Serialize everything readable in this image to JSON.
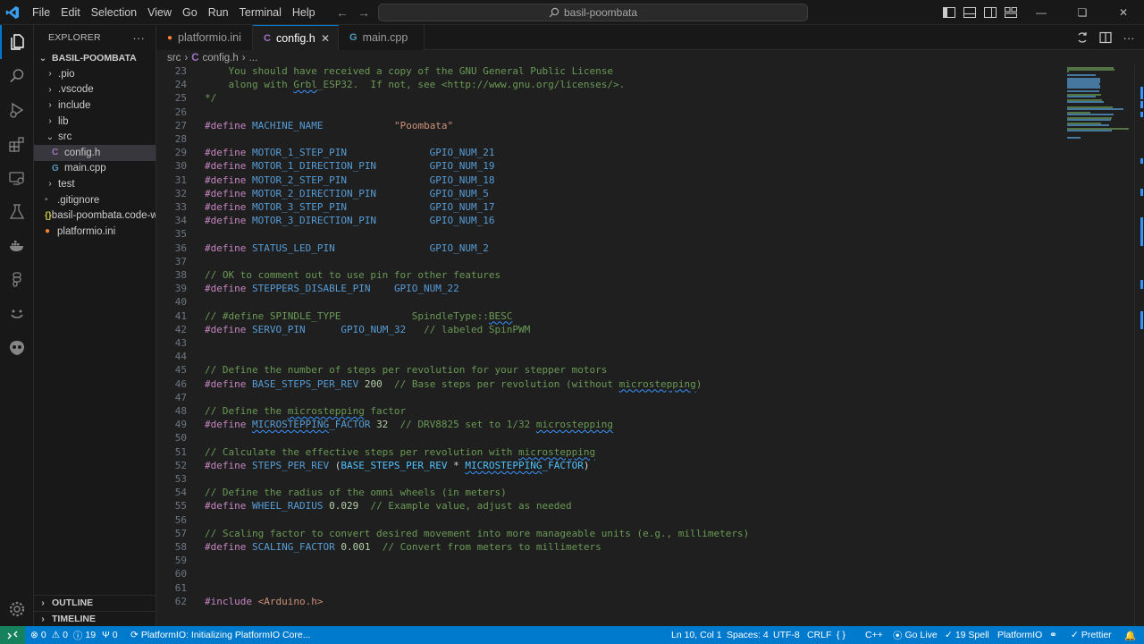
{
  "titlebar": {
    "menu": [
      "File",
      "Edit",
      "Selection",
      "View",
      "Go",
      "Run",
      "Terminal",
      "Help"
    ],
    "search_text": "basil-poombata"
  },
  "explorer": {
    "title": "EXPLORER",
    "more": "···",
    "root": "BASIL-POOMBATA",
    "items": [
      {
        "label": ".pio",
        "type": "folder",
        "expanded": false,
        "depth": 1
      },
      {
        "label": ".vscode",
        "type": "folder",
        "expanded": false,
        "depth": 1
      },
      {
        "label": "include",
        "type": "folder",
        "expanded": false,
        "depth": 1
      },
      {
        "label": "lib",
        "type": "folder",
        "expanded": false,
        "depth": 1
      },
      {
        "label": "src",
        "type": "folder",
        "expanded": true,
        "depth": 1
      },
      {
        "label": "config.h",
        "type": "c-header",
        "depth": 2,
        "selected": true
      },
      {
        "label": "main.cpp",
        "type": "cpp",
        "depth": 2
      },
      {
        "label": "test",
        "type": "folder",
        "expanded": false,
        "depth": 1
      },
      {
        "label": ".gitignore",
        "type": "gitignore",
        "depth": 1
      },
      {
        "label": "basil-poombata.code-workspace",
        "type": "json",
        "depth": 1
      },
      {
        "label": "platformio.ini",
        "type": "platformio",
        "depth": 1
      }
    ],
    "outline": "OUTLINE",
    "timeline": "TIMELINE"
  },
  "tabs": [
    {
      "label": "platformio.ini",
      "active": false
    },
    {
      "label": "config.h",
      "active": true
    },
    {
      "label": "main.cpp",
      "active": false
    }
  ],
  "breadcrumb": {
    "folder": "src",
    "file": "config.h",
    "rest": "..."
  },
  "editor": {
    "lines": [
      {
        "n": "23",
        "t": [
          [
            "c",
            "    You should have received a copy of the GNU General Public License"
          ]
        ]
      },
      {
        "n": "24",
        "t": [
          [
            "c",
            "    along with "
          ],
          [
            "c sq",
            "Grbl"
          ],
          [
            "c",
            "_ESP32.  If not, see <http://www.gnu.org/licenses/>."
          ]
        ]
      },
      {
        "n": "25",
        "t": [
          [
            "c",
            "*/"
          ]
        ]
      },
      {
        "n": "26",
        "t": []
      },
      {
        "n": "27",
        "t": [
          [
            "k",
            "#define"
          ],
          [
            "t",
            " "
          ],
          [
            "m",
            "MACHINE_NAME"
          ],
          [
            "t",
            "            "
          ],
          [
            "s",
            "\"Poombata\""
          ]
        ]
      },
      {
        "n": "28",
        "t": []
      },
      {
        "n": "29",
        "t": [
          [
            "k",
            "#define"
          ],
          [
            "t",
            " "
          ],
          [
            "m",
            "MOTOR_1_STEP_PIN"
          ],
          [
            "t",
            "              "
          ],
          [
            "m",
            "GPIO_NUM_21"
          ]
        ]
      },
      {
        "n": "30",
        "t": [
          [
            "k",
            "#define"
          ],
          [
            "t",
            " "
          ],
          [
            "m",
            "MOTOR_1_DIRECTION_PIN"
          ],
          [
            "t",
            "         "
          ],
          [
            "m",
            "GPIO_NUM_19"
          ]
        ]
      },
      {
        "n": "31",
        "t": [
          [
            "k",
            "#define"
          ],
          [
            "t",
            " "
          ],
          [
            "m",
            "MOTOR_2_STEP_PIN"
          ],
          [
            "t",
            "              "
          ],
          [
            "m",
            "GPIO_NUM_18"
          ]
        ]
      },
      {
        "n": "32",
        "t": [
          [
            "k",
            "#define"
          ],
          [
            "t",
            " "
          ],
          [
            "m",
            "MOTOR_2_DIRECTION_PIN"
          ],
          [
            "t",
            "         "
          ],
          [
            "m",
            "GPIO_NUM_5"
          ]
        ]
      },
      {
        "n": "33",
        "t": [
          [
            "k",
            "#define"
          ],
          [
            "t",
            " "
          ],
          [
            "m",
            "MOTOR_3_STEP_PIN"
          ],
          [
            "t",
            "              "
          ],
          [
            "m",
            "GPIO_NUM_17"
          ]
        ]
      },
      {
        "n": "34",
        "t": [
          [
            "k",
            "#define"
          ],
          [
            "t",
            " "
          ],
          [
            "m",
            "MOTOR_3_DIRECTION_PIN"
          ],
          [
            "t",
            "         "
          ],
          [
            "m",
            "GPIO_NUM_16"
          ]
        ]
      },
      {
        "n": "35",
        "t": []
      },
      {
        "n": "36",
        "t": [
          [
            "k",
            "#define"
          ],
          [
            "t",
            " "
          ],
          [
            "m",
            "STATUS_LED_PIN"
          ],
          [
            "t",
            "                "
          ],
          [
            "m",
            "GPIO_NUM_2"
          ]
        ]
      },
      {
        "n": "37",
        "t": []
      },
      {
        "n": "38",
        "t": [
          [
            "c",
            "// OK to comment out to use pin for other features"
          ]
        ]
      },
      {
        "n": "39",
        "t": [
          [
            "k",
            "#define"
          ],
          [
            "t",
            " "
          ],
          [
            "m",
            "STEPPERS_DISABLE_PIN"
          ],
          [
            "t",
            "    "
          ],
          [
            "m",
            "GPIO_NUM_22"
          ]
        ]
      },
      {
        "n": "40",
        "t": []
      },
      {
        "n": "41",
        "t": [
          [
            "c",
            "// #define SPINDLE_TYPE            SpindleType::"
          ],
          [
            "c sq",
            "BESC"
          ]
        ]
      },
      {
        "n": "42",
        "t": [
          [
            "k",
            "#define"
          ],
          [
            "t",
            " "
          ],
          [
            "m",
            "SERVO_PIN"
          ],
          [
            "t",
            "      "
          ],
          [
            "m",
            "GPIO_NUM_32"
          ],
          [
            "t",
            "   "
          ],
          [
            "c",
            "// labeled SpinPWM"
          ]
        ]
      },
      {
        "n": "43",
        "t": []
      },
      {
        "n": "44",
        "t": []
      },
      {
        "n": "45",
        "t": [
          [
            "c",
            "// Define the number of steps per revolution for your stepper motors"
          ]
        ]
      },
      {
        "n": "46",
        "t": [
          [
            "k",
            "#define"
          ],
          [
            "t",
            " "
          ],
          [
            "m",
            "BASE_STEPS_PER_REV"
          ],
          [
            "t",
            " "
          ],
          [
            "n",
            "200"
          ],
          [
            "t",
            "  "
          ],
          [
            "c",
            "// Base steps per revolution (without "
          ],
          [
            "c sq",
            "microstepping"
          ],
          [
            "c",
            ")"
          ]
        ]
      },
      {
        "n": "47",
        "t": []
      },
      {
        "n": "48",
        "t": [
          [
            "c",
            "// Define the "
          ],
          [
            "c sq",
            "microstepping"
          ],
          [
            "c",
            " factor"
          ]
        ]
      },
      {
        "n": "49",
        "t": [
          [
            "k",
            "#define"
          ],
          [
            "t",
            " "
          ],
          [
            "m sq",
            "MICROSTEPPING"
          ],
          [
            "m",
            "_FACTOR"
          ],
          [
            "t",
            " "
          ],
          [
            "n",
            "32"
          ],
          [
            "t",
            "  "
          ],
          [
            "c",
            "// DRV8825 set to 1/32 "
          ],
          [
            "c sq",
            "microstepping"
          ]
        ]
      },
      {
        "n": "50",
        "t": []
      },
      {
        "n": "51",
        "t": [
          [
            "c",
            "// Calculate the effective steps per revolution with "
          ],
          [
            "c sq",
            "microstepping"
          ]
        ]
      },
      {
        "n": "52",
        "t": [
          [
            "k",
            "#define"
          ],
          [
            "t",
            " "
          ],
          [
            "m",
            "STEPS_PER_REV"
          ],
          [
            "t",
            " "
          ],
          [
            "p",
            "("
          ],
          [
            "g",
            "BASE_STEPS_PER_REV"
          ],
          [
            "p",
            " * "
          ],
          [
            "g sq",
            "MICROSTEPPING"
          ],
          [
            "g",
            "_FACTOR"
          ],
          [
            "p",
            ")"
          ]
        ]
      },
      {
        "n": "53",
        "t": []
      },
      {
        "n": "54",
        "t": [
          [
            "c",
            "// Define the radius of the omni wheels (in meters)"
          ]
        ]
      },
      {
        "n": "55",
        "t": [
          [
            "k",
            "#define"
          ],
          [
            "t",
            " "
          ],
          [
            "m",
            "WHEEL_RADIUS"
          ],
          [
            "t",
            " "
          ],
          [
            "n",
            "0.029"
          ],
          [
            "t",
            "  "
          ],
          [
            "c",
            "// Example value, adjust as needed"
          ]
        ]
      },
      {
        "n": "56",
        "t": []
      },
      {
        "n": "57",
        "t": [
          [
            "c",
            "// Scaling factor to convert desired movement into more manageable units (e.g., millimeters)"
          ]
        ]
      },
      {
        "n": "58",
        "t": [
          [
            "k",
            "#define"
          ],
          [
            "t",
            " "
          ],
          [
            "m",
            "SCALING_FACTOR"
          ],
          [
            "t",
            " "
          ],
          [
            "n",
            "0.001"
          ],
          [
            "t",
            "  "
          ],
          [
            "c",
            "// Convert from meters to millimeters"
          ]
        ]
      },
      {
        "n": "59",
        "t": []
      },
      {
        "n": "60",
        "t": []
      },
      {
        "n": "61",
        "t": []
      },
      {
        "n": "62",
        "t": [
          [
            "k",
            "#include"
          ],
          [
            "t",
            " "
          ],
          [
            "s",
            "<Arduino.h>"
          ]
        ]
      }
    ]
  },
  "statusbar": {
    "errors": "0",
    "warnings": "0",
    "info": "19",
    "ports": "0",
    "task": "PlatformIO: Initializing PlatformIO Core...",
    "cursor": "Ln 10, Col 1",
    "spaces": "Spaces: 4",
    "encoding": "UTF-8",
    "eol": "CRLF",
    "braces": "{ }",
    "language": "C++",
    "golive": "Go Live",
    "spell": "19 Spell",
    "platformio": "PlatformIO",
    "prettier": "Prettier"
  },
  "colors": {
    "accent": "#0078d4",
    "statusbar": "#007acc",
    "keyword": "#c586c0",
    "macro": "#569cd6",
    "comment": "#6a9955",
    "string": "#ce9178",
    "number": "#b5cea8"
  }
}
